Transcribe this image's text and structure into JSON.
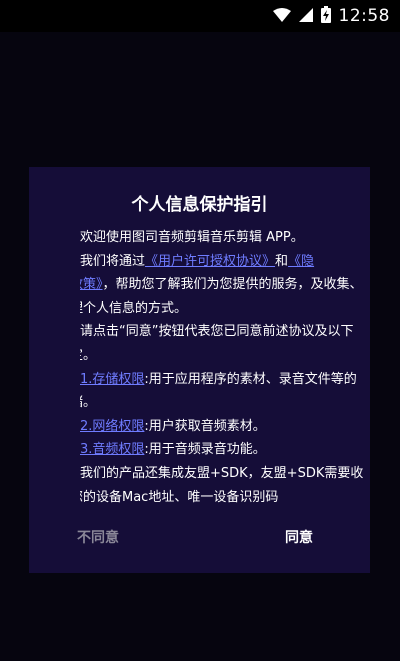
{
  "status_bar": {
    "time": "12:58",
    "icons": [
      "wifi-icon",
      "signal-icon",
      "battery-charging-icon"
    ]
  },
  "dialog": {
    "title": "个人信息保护指引",
    "welcome": "欢迎使用图司音频剪辑音乐剪辑 APP。",
    "notice_prefix": "我们将通过",
    "link_license": "《用户许可授权协议》",
    "notice_and": "和",
    "link_privacy_part1": "《隐",
    "link_privacy_part2": "私政策》",
    "notice_suffix": "，帮助您了解我们为您提供的服务，及收集、处理个人信息的方式。",
    "consent": "请点击“同意”按钮代表您已同意前述协议及以下约定。",
    "permissions": [
      {
        "label": "1.存储权限",
        "desc": ":用于应用程序的素材、录音文件等的存储。"
      },
      {
        "label": "2.网络权限",
        "desc": ":用户获取音频素材。"
      },
      {
        "label": "3.音频权限",
        "desc": ":用于音频录音功能。"
      }
    ],
    "sdk_text": "我们的产品还集成友盟+SDK，友盟+SDK需要收集您的设备Mac地址、唯一设备识别码",
    "disagree_label": "不同意",
    "agree_label": "同意"
  },
  "colors": {
    "background": "#06050f",
    "dialog_bg": "#150d38",
    "link": "#6f7cff",
    "disagree_text": "#8a8798"
  }
}
